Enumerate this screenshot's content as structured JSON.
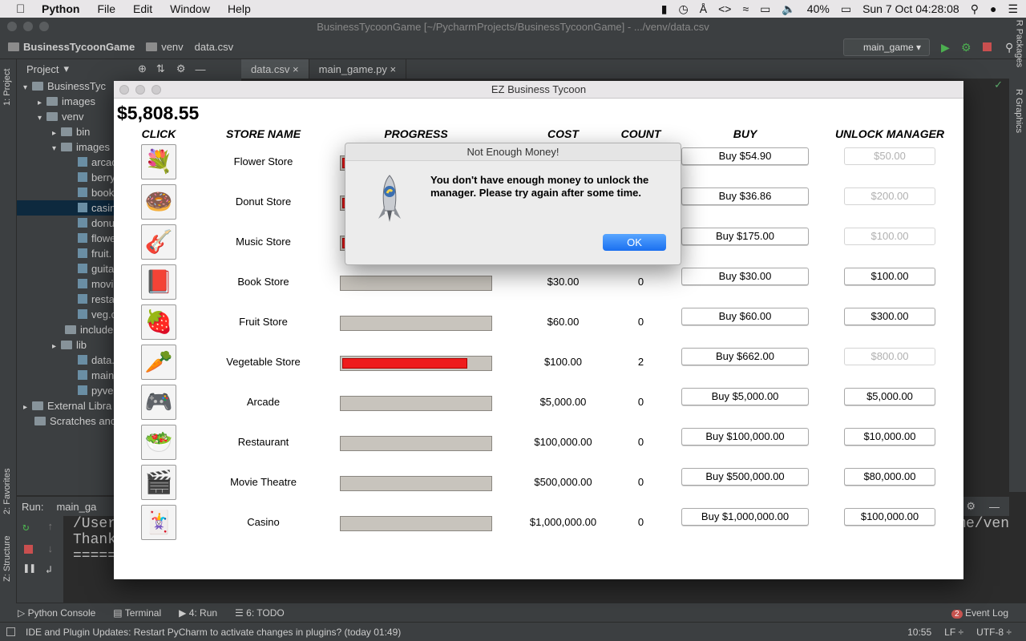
{
  "menubar": {
    "app_name": "Python",
    "items": [
      "File",
      "Edit",
      "Window",
      "Help"
    ],
    "battery": "40%",
    "datetime": "Sun 7 Oct  04:28:08"
  },
  "ide": {
    "window_title": "BusinessTycoonGame [~/PycharmProjects/BusinessTycoonGame] - .../venv/data.csv",
    "breadcrumbs": [
      "BusinessTycoonGame",
      "venv",
      "data.csv"
    ],
    "run_config": "main_game",
    "project_label": "Project",
    "tabs": [
      "data.csv",
      "main_game.py"
    ],
    "left_tool_labels": [
      "1: Project",
      "2: Favorites",
      "Z: Structure"
    ],
    "right_tool_labels": [
      "R Packages",
      "R Graphics"
    ],
    "tree": [
      {
        "label": "BusinessTyc",
        "kind": "folder"
      },
      {
        "label": "images",
        "kind": "folder"
      },
      {
        "label": "venv",
        "kind": "folder"
      },
      {
        "label": "bin",
        "kind": "folder"
      },
      {
        "label": "images",
        "kind": "folder"
      },
      {
        "label": "arcac",
        "kind": "file"
      },
      {
        "label": "berry",
        "kind": "file"
      },
      {
        "label": "book",
        "kind": "file"
      },
      {
        "label": "casin",
        "kind": "file"
      },
      {
        "label": "donu",
        "kind": "file"
      },
      {
        "label": "flowe",
        "kind": "file"
      },
      {
        "label": "fruit.",
        "kind": "file"
      },
      {
        "label": "guita",
        "kind": "file"
      },
      {
        "label": "movi",
        "kind": "file"
      },
      {
        "label": "resta",
        "kind": "file"
      },
      {
        "label": "veg.c",
        "kind": "file"
      },
      {
        "label": "include",
        "kind": "folder"
      },
      {
        "label": "lib",
        "kind": "folder"
      },
      {
        "label": "data.cs",
        "kind": "file"
      },
      {
        "label": "main_ga",
        "kind": "file"
      },
      {
        "label": "pyvenv.",
        "kind": "file"
      },
      {
        "label": "External Libra",
        "kind": "folder"
      },
      {
        "label": "Scratches anc",
        "kind": "folder"
      }
    ],
    "run_label": "Run:",
    "run_tab": "main_ga",
    "console_lines": [
      "/User",
      "Thank",
      "=====",
      "me/ven"
    ],
    "bottom_tabs": [
      "Python Console",
      "Terminal",
      "4: Run",
      "6: TODO"
    ],
    "event_log": "Event Log",
    "event_count": "2",
    "status_message": "IDE and Plugin Updates: Restart PyCharm to activate changes in plugins? (today 01:49)",
    "cursor_pos": "10:55",
    "line_sep": "LF ÷",
    "encoding": "UTF-8 ÷"
  },
  "game": {
    "title": "EZ Business Tycoon",
    "money": "$5,808.55",
    "headers": {
      "click": "CLICK",
      "store_name": "STORE NAME",
      "progress": "PROGRESS",
      "cost": "COST",
      "count": "COUNT",
      "buy": "BUY",
      "unlock_manager": "UNLOCK MANAGER"
    },
    "stores": [
      {
        "icon": "flower-icon",
        "glyph": "💐",
        "name": "Flower Store",
        "progress": 0.02,
        "cost": "",
        "count": "",
        "buy": "Buy $54.90",
        "manager": "$50.00",
        "manager_enabled": false
      },
      {
        "icon": "donut-icon",
        "glyph": "🍩",
        "name": "Donut Store",
        "progress": 0.02,
        "cost": "",
        "count": "",
        "buy": "Buy $36.86",
        "manager": "$200.00",
        "manager_enabled": false
      },
      {
        "icon": "guitar-icon",
        "glyph": "🎸",
        "name": "Music Store",
        "progress": 0.02,
        "cost": "",
        "count": "",
        "buy": "Buy $175.00",
        "manager": "$100.00",
        "manager_enabled": false
      },
      {
        "icon": "book-icon",
        "glyph": "📕",
        "name": "Book Store",
        "progress": 0,
        "cost": "$30.00",
        "count": "0",
        "buy": "Buy $30.00",
        "manager": "$100.00",
        "manager_enabled": true
      },
      {
        "icon": "fruit-icon",
        "glyph": "🍓",
        "name": "Fruit Store",
        "progress": 0,
        "cost": "$60.00",
        "count": "0",
        "buy": "Buy $60.00",
        "manager": "$300.00",
        "manager_enabled": true
      },
      {
        "icon": "vegetable-icon",
        "glyph": "🥕",
        "name": "Vegetable Store",
        "progress": 0.85,
        "cost": "$100.00",
        "count": "2",
        "buy": "Buy $662.00",
        "manager": "$800.00",
        "manager_enabled": false
      },
      {
        "icon": "gamepad-icon",
        "glyph": "🎮",
        "name": "Arcade",
        "progress": 0,
        "cost": "$5,000.00",
        "count": "0",
        "buy": "Buy $5,000.00",
        "manager": "$5,000.00",
        "manager_enabled": true
      },
      {
        "icon": "salad-icon",
        "glyph": "🥗",
        "name": "Restaurant",
        "progress": 0,
        "cost": "$100,000.00",
        "count": "0",
        "buy": "Buy $100,000.00",
        "manager": "$10,000.00",
        "manager_enabled": true
      },
      {
        "icon": "clapperboard-icon",
        "glyph": "🎬",
        "name": "Movie Theatre",
        "progress": 0,
        "cost": "$500,000.00",
        "count": "0",
        "buy": "Buy $500,000.00",
        "manager": "$80,000.00",
        "manager_enabled": true
      },
      {
        "icon": "cards-icon",
        "glyph": "🃏",
        "name": "Casino",
        "progress": 0,
        "cost": "$1,000,000.00",
        "count": "0",
        "buy": "Buy $1,000,000.00",
        "manager": "$100,000.00",
        "manager_enabled": true
      }
    ]
  },
  "dialog": {
    "title": "Not Enough Money!",
    "message": "You don't have enough money to unlock the manager. Please try again after some time.",
    "ok_label": "OK"
  }
}
